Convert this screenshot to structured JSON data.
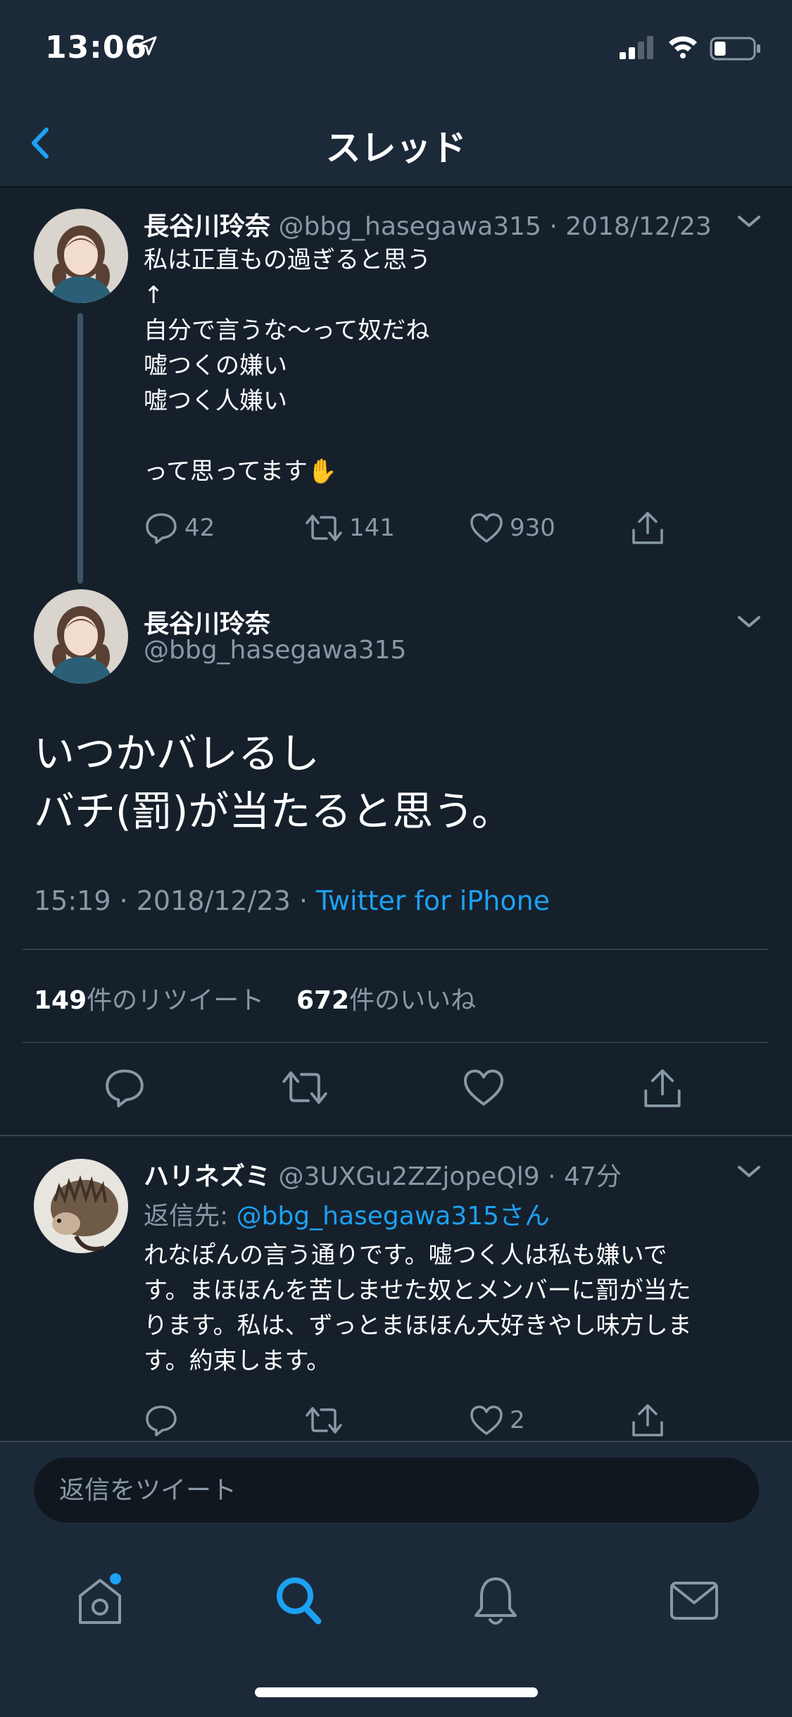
{
  "status_bar": {
    "time": "13:06",
    "battery_level": 0.3
  },
  "header": {
    "title": "スレッド"
  },
  "tweets": [
    {
      "author": "長谷川玲奈",
      "handle": "@bbg_hasegawa315",
      "date": "· 2018/12/23",
      "lines": [
        "私は正直もの過ぎると思う",
        "↑",
        "自分で言うな〜って奴だね",
        "嘘つくの嫌い",
        "嘘つく人嫌い",
        "",
        "って思ってます✋"
      ],
      "replies": "42",
      "retweets": "141",
      "likes": "930"
    }
  ],
  "main_tweet": {
    "author": "長谷川玲奈",
    "handle": "@bbg_hasegawa315",
    "lines": [
      "いつかバレるし",
      "バチ(罰)が当たると思う。"
    ],
    "timestamp": "15:19 · 2018/12/23 · ",
    "source": "Twitter for iPhone",
    "retweet_count": "149",
    "retweet_label": "件のリツイート",
    "like_count": "672",
    "like_label": "件のいいね"
  },
  "reply": {
    "author": "ハリネズミ",
    "handle": "@3UXGu2ZZjopeQl9",
    "time": "· 47分",
    "reply_to_label": "返信先: ",
    "reply_to_handle": "@bbg_hasegawa315さん",
    "lines": [
      "れなぽんの言う通りです。嘘つく人は私も嫌いで",
      "す。まほほんを苦しませた奴とメンバーに罰が当た",
      "ります。私は、ずっとまほほん大好きやし味方しま",
      "す。約束します。"
    ],
    "likes": "2"
  },
  "composer": {
    "placeholder": "返信をツイート"
  },
  "colors": {
    "accent": "#1da1f2",
    "background": "#15202b",
    "muted": "#8899a6"
  }
}
